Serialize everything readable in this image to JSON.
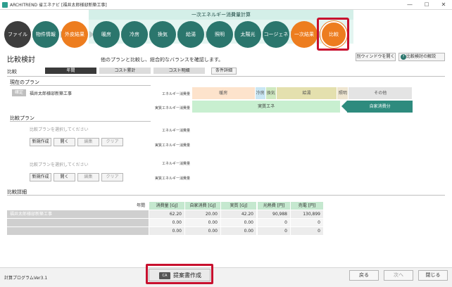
{
  "window": {
    "title": "ARCHITREND 省エネナビ [福井太郎様邸新築工事]",
    "minimize": "—",
    "maximize": "□",
    "close": "✕"
  },
  "steps": {
    "band_title": "一次エネルギー消費量計算",
    "items": [
      "ファイル",
      "物件情報",
      "外皮結果",
      "暖房",
      "冷房",
      "換気",
      "給湯",
      "照明",
      "太陽光",
      "コージェネ",
      "一次結果",
      "比較"
    ]
  },
  "header": {
    "title": "比較検討",
    "description": "他のプランと比較し、総合的なバランスを確認します。",
    "open_window_label": "別ウィンドウを開く",
    "help_label": "比較検討の解説",
    "help_icon": "?"
  },
  "tabs": {
    "label": "比較",
    "items": [
      "年間",
      "コスト累計",
      "コスト明細"
    ],
    "detail_label": "条件詳細"
  },
  "current_plan": {
    "section_title": "現在のプラン",
    "badge": "確定",
    "name": "福井太郎様邸新築工事"
  },
  "compare_plans": {
    "section_title": "比較プラン",
    "placeholder": "比較プランを選択してください",
    "buttons": [
      "新規作成",
      "開く",
      "編集",
      "クリア"
    ]
  },
  "bars": {
    "energy_label": "エネルギー消費量",
    "actual_label": "実質エネルギー消費量",
    "segments": [
      {
        "name": "暖房",
        "value": 17.8,
        "color": "#fde3cc"
      },
      {
        "name": "冷房",
        "value": 3.0,
        "color": "#c9e6f3"
      },
      {
        "name": "換気",
        "value": 3.0,
        "color": "#cfe9c0"
      },
      {
        "name": "給湯",
        "value": 17.2,
        "color": "#e4e0ae"
      },
      {
        "name": "照明",
        "value": 3.2,
        "color": "#eee5d0"
      },
      {
        "name": "その他",
        "value": 18.0,
        "color": "#e4e4e4"
      }
    ],
    "actual_text": "実質エネ",
    "actual_value": 42.2,
    "self_text": "自家消費分",
    "self_value": 20.0
  },
  "details": {
    "section_title": "比較詳細",
    "period": "年間",
    "energy_headers": [
      "消費量 [GJ]",
      "自家消費 [GJ]",
      "実質 [GJ]"
    ],
    "cost_headers": [
      "光熱費 [円]",
      "売電 [円]"
    ],
    "rows": [
      {
        "name": "福井太郎様邸新築工事",
        "values": [
          "62.20",
          "20.00",
          "42.20"
        ],
        "costs": [
          "90,988",
          "130,899"
        ]
      },
      {
        "name": "",
        "values": [
          "0.00",
          "0.00",
          "0.00"
        ],
        "costs": [
          "0",
          "0"
        ]
      },
      {
        "name": "",
        "values": [
          "0.00",
          "0.00",
          "0.00"
        ],
        "costs": [
          "0",
          "0"
        ]
      }
    ]
  },
  "footer": {
    "version": "計算プログラムVer3.1",
    "proposal_icon": "CA",
    "proposal_label": "提案書作成",
    "back": "戻る",
    "next": "次へ",
    "close": "閉じる"
  },
  "colors": {
    "dark": "#3d3d3d",
    "teal": "#2b766d",
    "orange": "#ed7d1f",
    "actual": "#c8efd0",
    "self": "#2e8b7e",
    "highlight": "#c8102e"
  }
}
